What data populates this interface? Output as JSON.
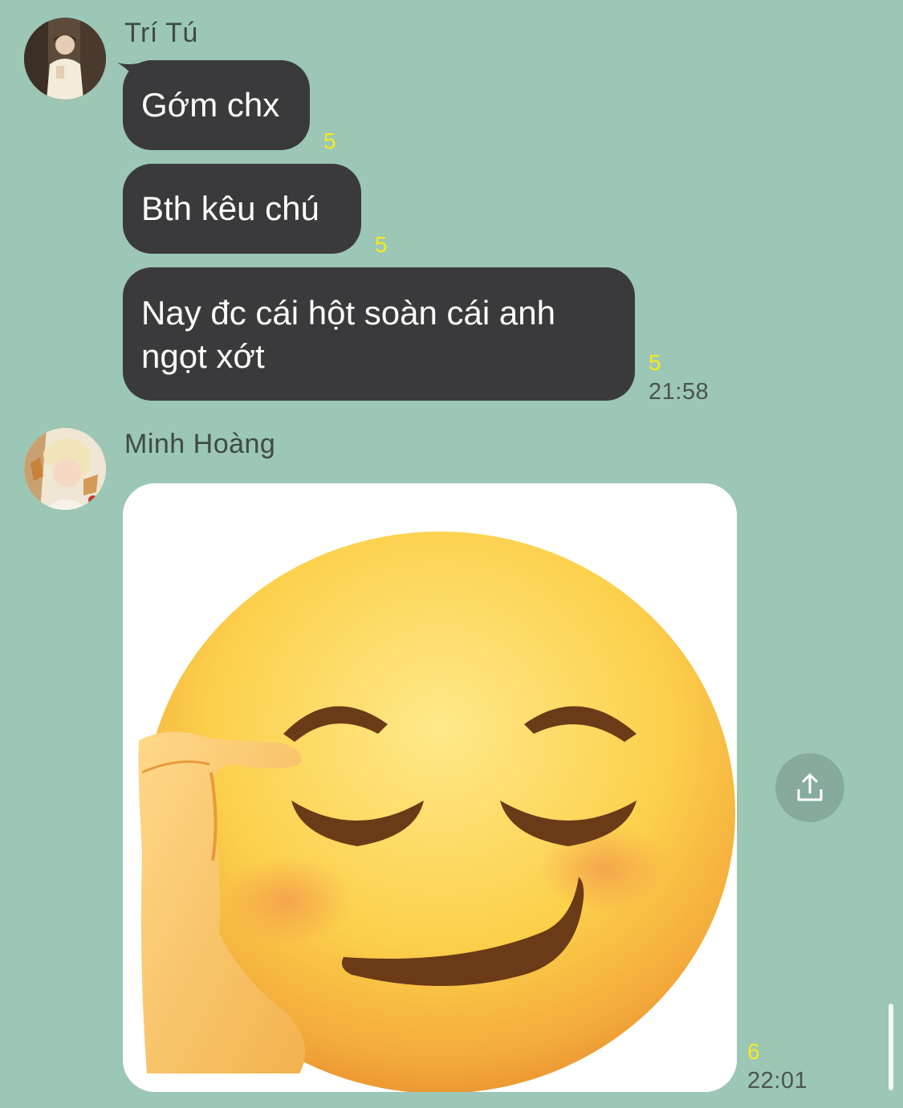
{
  "messages_top": {
    "sender_name": "Trí Tú",
    "bubbles": [
      {
        "text": "Gớm chx",
        "read_count": "5"
      },
      {
        "text": "Bth kêu chú",
        "read_count": "5"
      },
      {
        "text": "Nay đc cái hột soàn cái anh ngọt xớt",
        "read_count": "5",
        "time": "21:58"
      }
    ]
  },
  "messages_bottom": {
    "sender_name": "Minh Hoàng",
    "image_icon": "smirking-face-with-hand-on-forehead-emoji",
    "read_count": "6",
    "time": "22:01"
  },
  "share_icon": "share-upload-icon",
  "colors": {
    "background": "#9cc6b5",
    "bubble": "#3a3a3c",
    "read_count": "#f5ea1c"
  }
}
